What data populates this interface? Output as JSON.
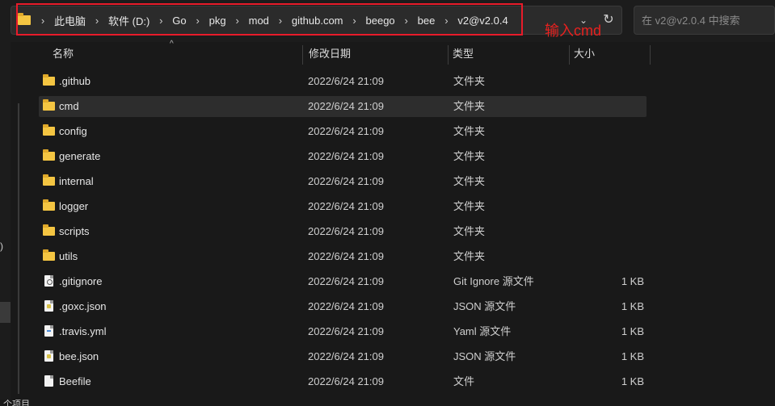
{
  "breadcrumbs": [
    "此电脑",
    "软件 (D:)",
    "Go",
    "pkg",
    "mod",
    "github.com",
    "beego",
    "bee",
    "v2@v2.0.4"
  ],
  "annotation": "输入cmd",
  "search": {
    "placeholder": "在 v2@v2.0.4 中搜索"
  },
  "columns": {
    "name": "名称",
    "date": "修改日期",
    "type": "类型",
    "size": "大小"
  },
  "rows": [
    {
      "name": ".github",
      "date": "2022/6/24 21:09",
      "type": "文件夹",
      "size": "",
      "icon": "folder-icon"
    },
    {
      "name": "cmd",
      "date": "2022/6/24 21:09",
      "type": "文件夹",
      "size": "",
      "icon": "folder-icon"
    },
    {
      "name": "config",
      "date": "2022/6/24 21:09",
      "type": "文件夹",
      "size": "",
      "icon": "folder-icon"
    },
    {
      "name": "generate",
      "date": "2022/6/24 21:09",
      "type": "文件夹",
      "size": "",
      "icon": "folder-icon"
    },
    {
      "name": "internal",
      "date": "2022/6/24 21:09",
      "type": "文件夹",
      "size": "",
      "icon": "folder-icon"
    },
    {
      "name": "logger",
      "date": "2022/6/24 21:09",
      "type": "文件夹",
      "size": "",
      "icon": "folder-icon"
    },
    {
      "name": "scripts",
      "date": "2022/6/24 21:09",
      "type": "文件夹",
      "size": "",
      "icon": "folder-icon"
    },
    {
      "name": "utils",
      "date": "2022/6/24 21:09",
      "type": "文件夹",
      "size": "",
      "icon": "folder-icon"
    },
    {
      "name": ".gitignore",
      "date": "2022/6/24 21:09",
      "type": "Git Ignore 源文件",
      "size": "1 KB",
      "icon": "gitignore-file-icon"
    },
    {
      "name": ".goxc.json",
      "date": "2022/6/24 21:09",
      "type": "JSON 源文件",
      "size": "1 KB",
      "icon": "json-file-icon"
    },
    {
      "name": ".travis.yml",
      "date": "2022/6/24 21:09",
      "type": "Yaml 源文件",
      "size": "1 KB",
      "icon": "yaml-file-icon"
    },
    {
      "name": "bee.json",
      "date": "2022/6/24 21:09",
      "type": "JSON 源文件",
      "size": "1 KB",
      "icon": "json-file-icon"
    },
    {
      "name": "Beefile",
      "date": "2022/6/24 21:09",
      "type": "文件",
      "size": "1 KB",
      "icon": "file-icon"
    }
  ],
  "status": {
    "text": "个项目"
  },
  "colors": {
    "background": "#191919",
    "highlight_box": "#e81b2a",
    "folder": "#f4c542",
    "selected_row": "#2d2d2d"
  }
}
